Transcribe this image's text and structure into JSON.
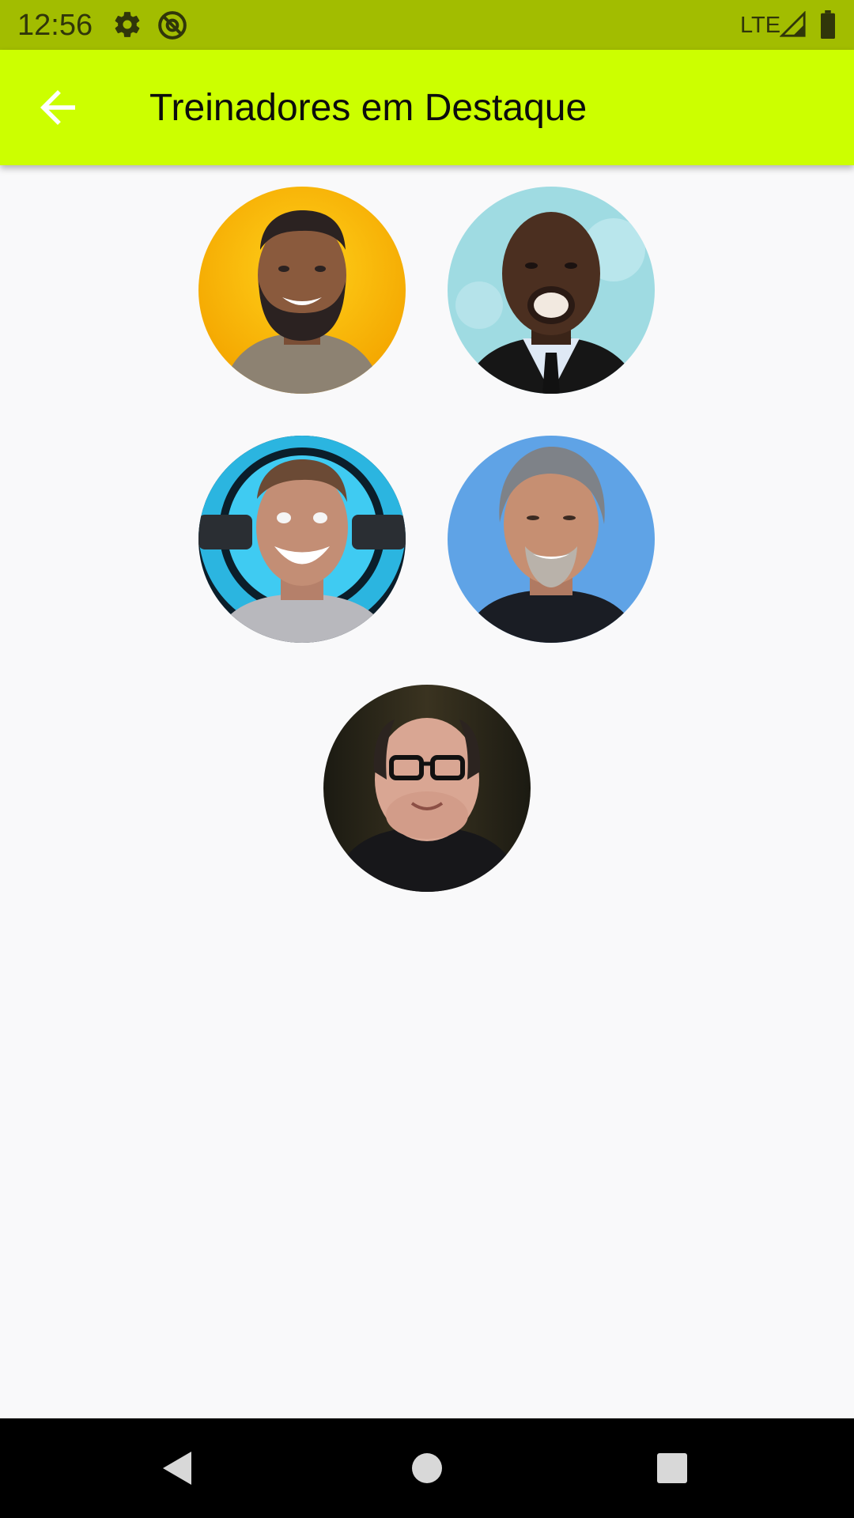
{
  "status_bar": {
    "time": "12:56",
    "network": "LTE",
    "icons": [
      "settings-icon",
      "at-sign-icon",
      "signal-icon",
      "battery-icon"
    ]
  },
  "app_bar": {
    "back_icon": "arrow-left-icon",
    "title": "Treinadores em Destaque",
    "background_color": "#ccff00"
  },
  "trainers": [
    {
      "background": "yellow",
      "icon": "trainer-photo"
    },
    {
      "background": "light-blue",
      "icon": "trainer-photo"
    },
    {
      "background": "cyan",
      "icon": "trainer-photo"
    },
    {
      "background": "blue",
      "icon": "trainer-photo"
    },
    {
      "background": "dark",
      "icon": "trainer-photo"
    }
  ],
  "nav_bar": {
    "buttons": [
      "nav-back-icon",
      "nav-home-icon",
      "nav-recents-icon"
    ]
  }
}
